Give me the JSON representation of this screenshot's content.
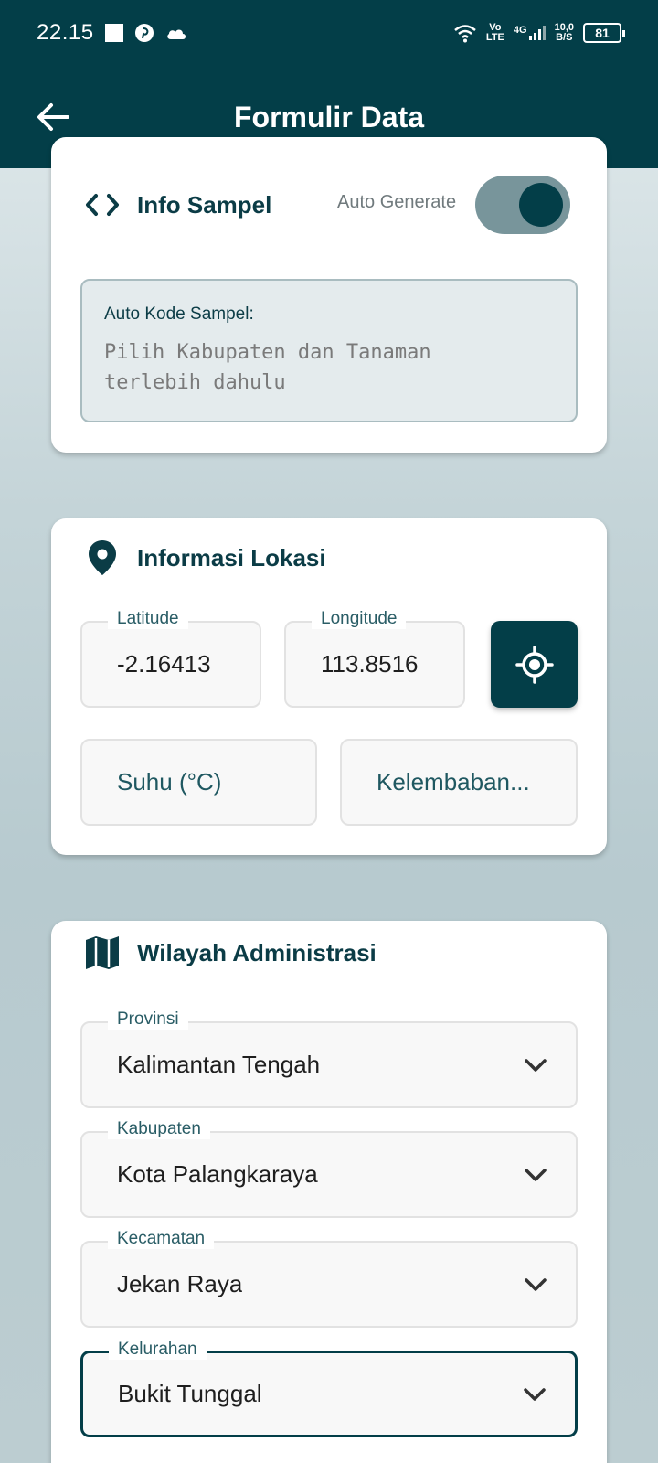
{
  "status_bar": {
    "time": "22.15",
    "volte_top": "Vo",
    "volte_bottom": "LTE",
    "network": "4G",
    "speed_top": "10,0",
    "speed_bottom": "B/S",
    "battery": "81"
  },
  "app_bar": {
    "title": "Formulir Data"
  },
  "info_sampel": {
    "title": "Info Sampel",
    "toggle_label": "Auto Generate",
    "toggle_on": true,
    "autocode_label": "Auto Kode Sampel:",
    "autocode_value_line1": "Pilih Kabupaten dan Tanaman",
    "autocode_value_line2": "terlebih dahulu"
  },
  "lokasi": {
    "title": "Informasi Lokasi",
    "latitude_label": "Latitude",
    "latitude_value": "-2.16413",
    "longitude_label": "Longitude",
    "longitude_value": "113.8516",
    "suhu_placeholder": "Suhu (°C)",
    "kelembaban_placeholder": "Kelembaban..."
  },
  "wilayah": {
    "title": "Wilayah Administrasi",
    "provinsi_label": "Provinsi",
    "provinsi_value": "Kalimantan Tengah",
    "kabupaten_label": "Kabupaten",
    "kabupaten_value": "Kota Palangkaraya",
    "kecamatan_label": "Kecamatan",
    "kecamatan_value": "Jekan Raya",
    "kelurahan_label": "Kelurahan",
    "kelurahan_value": "Bukit Tunggal"
  },
  "colors": {
    "primary": "#033e48",
    "toggle_track": "#78959b",
    "card_bg": "#ffffff"
  }
}
